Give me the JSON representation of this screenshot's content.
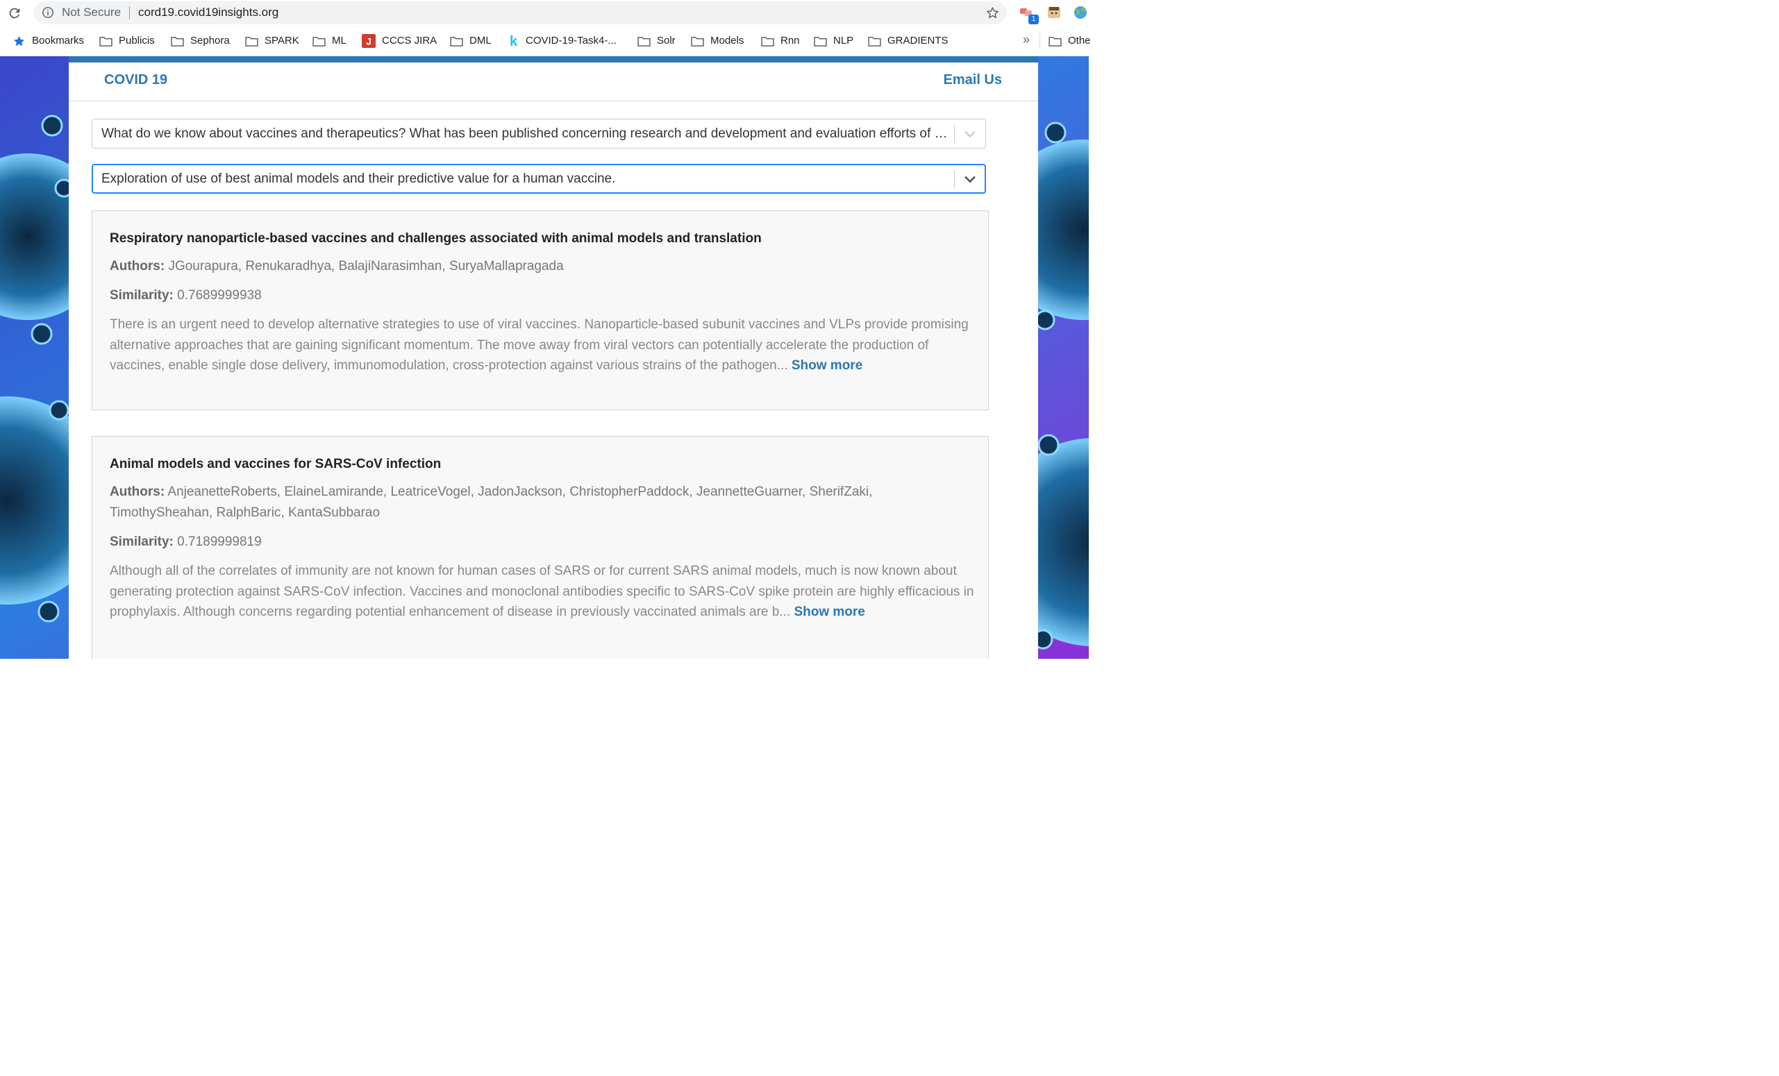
{
  "browser": {
    "security_label": "Not Secure",
    "url": "cord19.covid19insights.org",
    "extension_badge": "1",
    "bookmarks": [
      {
        "label": "Bookmarks",
        "icon": "star-icon"
      },
      {
        "label": "Publicis",
        "icon": "folder-icon"
      },
      {
        "label": "Sephora",
        "icon": "folder-icon"
      },
      {
        "label": "SPARK",
        "icon": "folder-icon"
      },
      {
        "label": "ML",
        "icon": "folder-icon"
      },
      {
        "label": "CCCS JIRA",
        "icon": "jira-icon"
      },
      {
        "label": "DML",
        "icon": "folder-icon"
      },
      {
        "label": "COVID-19-Task4-...",
        "icon": "kaggle-icon"
      },
      {
        "label": "Solr",
        "icon": "folder-icon"
      },
      {
        "label": "Models",
        "icon": "folder-icon"
      },
      {
        "label": "Rnn",
        "icon": "folder-icon"
      },
      {
        "label": "NLP",
        "icon": "folder-icon"
      },
      {
        "label": "GRADIENTS",
        "icon": "folder-icon"
      }
    ],
    "overflow_label": "»",
    "other_label": "Othe"
  },
  "site": {
    "brand": "COVID 19",
    "email_link": "Email Us",
    "accent_color": "#2b77b4"
  },
  "filters": {
    "question": "What do we know about vaccines and therapeutics? What has been published concerning research and development and evaluation efforts of vaccines and therapeutics?",
    "subtask": "Exploration of use of best animal models and their predictive value for a human vaccine."
  },
  "results": [
    {
      "title": "Respiratory nanoparticle-based vaccines and challenges associated with animal models and translation",
      "authors_label": "Authors:",
      "authors": "JGourapura, Renukaradhya, BalajiNarasimhan, SuryaMallapragada",
      "similarity_label": "Similarity:",
      "similarity": "0.7689999938",
      "abstract": "There is an urgent need to develop alternative strategies to use of viral vaccines. Nanoparticle-based subunit vaccines and VLPs provide promising alternative approaches that are gaining significant momentum. The move away from viral vectors can potentially accelerate the production of vaccines, enable single dose delivery, immunomodulation, cross-protection against various strains of the pathogen...",
      "show_more": "Show more"
    },
    {
      "title": "Animal models and vaccines for SARS-CoV infection",
      "authors_label": "Authors:",
      "authors": "AnjeanetteRoberts, ElaineLamirande, LeatriceVogel, JadonJackson, ChristopherPaddock, JeannetteGuarner, SherifZaki, TimothySheahan, RalphBaric, KantaSubbarao",
      "similarity_label": "Similarity:",
      "similarity": "0.7189999819",
      "abstract": "Although all of the correlates of immunity are not known for human cases of SARS or for current SARS animal models, much is now known about generating protection against SARS-CoV infection. Vaccines and monoclonal antibodies specific to SARS-CoV spike protein are highly efficacious in prophylaxis. Although concerns regarding potential enhancement of disease in previously vaccinated animals are b...",
      "show_more": "Show more"
    }
  ]
}
